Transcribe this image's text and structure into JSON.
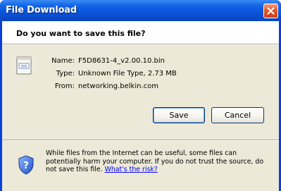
{
  "window": {
    "title": "File Download"
  },
  "dialog": {
    "question": "Do you want to save this file?",
    "name_label": "Name:",
    "name_value": "F5D8631-4_v2.00.10.bin",
    "type_label": "Type:",
    "type_value": "Unknown File Type, 2.73 MB",
    "from_label": "From:",
    "from_value": "networking.belkin.com"
  },
  "buttons": {
    "save_label": "Save",
    "cancel_label": "Cancel"
  },
  "warning": {
    "text": "While files from the Internet can be useful, some files can potentially harm your computer. If you do not trust the source, do not save this file. ",
    "link_text": "What's the risk?"
  },
  "icons": {
    "close": "close-icon",
    "file": "file-icon",
    "shield": "shield-question-icon"
  },
  "colors": {
    "titlebar": "#0a53d8",
    "close_button": "#e0562a",
    "client_bg": "#ece9d8",
    "link": "#0000ff"
  }
}
